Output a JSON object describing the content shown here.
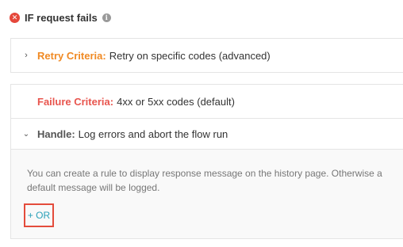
{
  "header": {
    "title": "IF request fails",
    "error_icon": "x-circle-icon",
    "info_icon": "info-icon"
  },
  "retry": {
    "chevron": "chevron-right-icon",
    "label": "Retry Criteria:",
    "value": "Retry on specific codes (advanced)"
  },
  "failure": {
    "label": "Failure Criteria:",
    "value": "4xx or 5xx codes (default)"
  },
  "handle": {
    "chevron": "chevron-down-icon",
    "label": "Handle:",
    "value": "Log errors and abort the flow run",
    "description": "You can create a rule to display response message on the history page. Otherwise a default message will be logged.",
    "or_button": "+ OR"
  },
  "colors": {
    "error_red": "#e5483b",
    "retry_orange": "#f08a24",
    "failure_red": "#e8554e",
    "link_teal": "#29a0b8",
    "highlight_box": "#e44c3c"
  }
}
